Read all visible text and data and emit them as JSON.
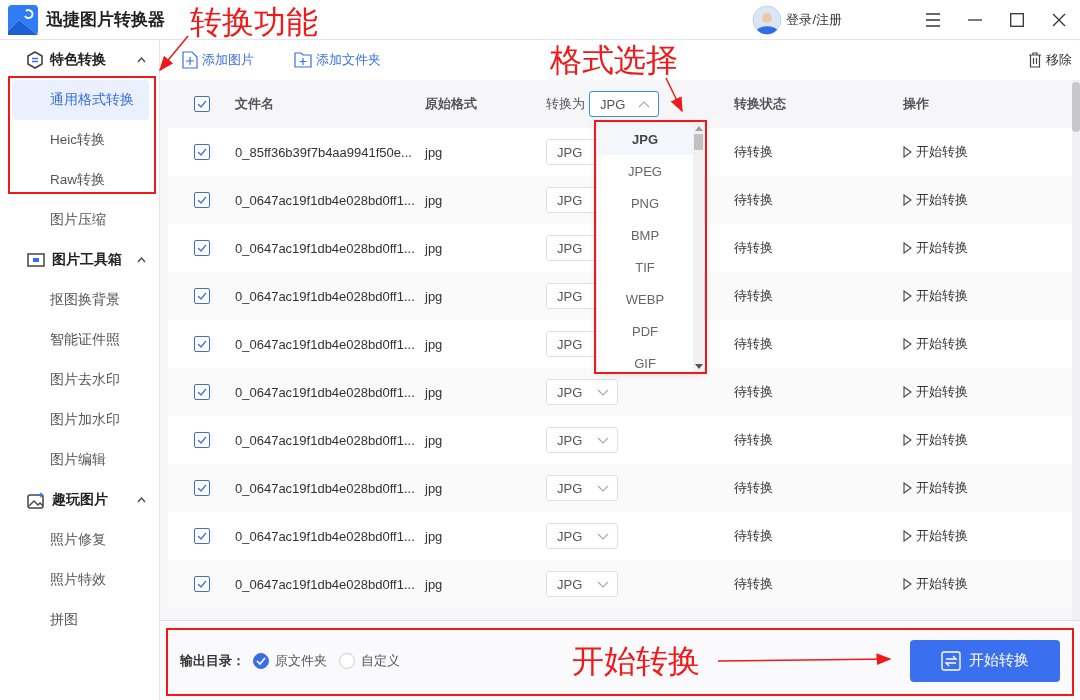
{
  "window": {
    "title": "迅捷图片转换器",
    "login": "登录/注册"
  },
  "sidebar": {
    "groups": [
      {
        "title": "特色转换",
        "expanded": true,
        "items": [
          {
            "label": "通用格式转换",
            "selected": true
          },
          {
            "label": "Heic转换",
            "selected": false
          },
          {
            "label": "Raw转换",
            "selected": false
          },
          {
            "label": "图片压缩",
            "selected": false
          }
        ]
      },
      {
        "title": "图片工具箱",
        "expanded": true,
        "items": [
          {
            "label": "抠图换背景",
            "selected": false
          },
          {
            "label": "智能证件照",
            "selected": false
          },
          {
            "label": "图片去水印",
            "selected": false
          },
          {
            "label": "图片加水印",
            "selected": false
          },
          {
            "label": "图片编辑",
            "selected": false
          }
        ]
      },
      {
        "title": "趣玩图片",
        "expanded": true,
        "items": [
          {
            "label": "照片修复",
            "selected": false
          },
          {
            "label": "照片特效",
            "selected": false
          },
          {
            "label": "拼图",
            "selected": false
          }
        ]
      }
    ]
  },
  "toolbar": {
    "add_image": "添加图片",
    "add_folder": "添加文件夹",
    "remove": "移除"
  },
  "table": {
    "select_all": {
      "checked": true
    },
    "columns": [
      "文件名",
      "原始格式",
      "转换为",
      "转换状态",
      "操作"
    ],
    "header_select": {
      "value": "JPG",
      "expanded": true
    },
    "rows": [
      {
        "checked": true,
        "name": "0_85ff36b39f7b4aa9941f50e...",
        "format": "jpg",
        "target": "JPG",
        "status": "待转换",
        "action": "开始转换"
      },
      {
        "checked": true,
        "name": "0_0647ac19f1db4e028bd0ff1...",
        "format": "jpg",
        "target": "JPG",
        "status": "待转换",
        "action": "开始转换"
      },
      {
        "checked": true,
        "name": "0_0647ac19f1db4e028bd0ff1...",
        "format": "jpg",
        "target": "JPG",
        "status": "待转换",
        "action": "开始转换"
      },
      {
        "checked": true,
        "name": "0_0647ac19f1db4e028bd0ff1...",
        "format": "jpg",
        "target": "JPG",
        "status": "待转换",
        "action": "开始转换"
      },
      {
        "checked": true,
        "name": "0_0647ac19f1db4e028bd0ff1...",
        "format": "jpg",
        "target": "JPG",
        "status": "待转换",
        "action": "开始转换"
      },
      {
        "checked": true,
        "name": "0_0647ac19f1db4e028bd0ff1...",
        "format": "jpg",
        "target": "JPG",
        "status": "待转换",
        "action": "开始转换"
      },
      {
        "checked": true,
        "name": "0_0647ac19f1db4e028bd0ff1...",
        "format": "jpg",
        "target": "JPG",
        "status": "待转换",
        "action": "开始转换"
      },
      {
        "checked": true,
        "name": "0_0647ac19f1db4e028bd0ff1...",
        "format": "jpg",
        "target": "JPG",
        "status": "待转换",
        "action": "开始转换"
      },
      {
        "checked": true,
        "name": "0_0647ac19f1db4e028bd0ff1...",
        "format": "jpg",
        "target": "JPG",
        "status": "待转换",
        "action": "开始转换"
      },
      {
        "checked": true,
        "name": "0_0647ac19f1db4e028bd0ff1...",
        "format": "jpg",
        "target": "JPG",
        "status": "待转换",
        "action": "开始转换"
      }
    ]
  },
  "format_dropdown": {
    "options": [
      {
        "label": "JPG",
        "selected": true
      },
      {
        "label": "JPEG",
        "selected": false
      },
      {
        "label": "PNG",
        "selected": false
      },
      {
        "label": "BMP",
        "selected": false
      },
      {
        "label": "TIF",
        "selected": false
      },
      {
        "label": "WEBP",
        "selected": false
      },
      {
        "label": "PDF",
        "selected": false
      },
      {
        "label": "GIF",
        "selected": false
      }
    ]
  },
  "footer": {
    "output_label": "输出目录：",
    "options": [
      {
        "label": "原文件夹",
        "selected": true
      },
      {
        "label": "自定义",
        "selected": false
      }
    ],
    "start_button": "开始转换"
  },
  "annotations": [
    {
      "text": "转换功能"
    },
    {
      "text": "格式选择"
    },
    {
      "text": "开始转换"
    }
  ]
}
